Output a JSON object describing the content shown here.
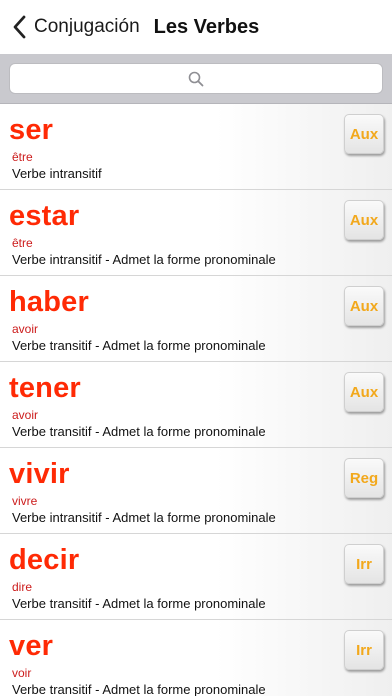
{
  "navbar": {
    "back_label": "Conjugación",
    "title": "Les Verbes"
  },
  "search": {
    "placeholder": "",
    "value": ""
  },
  "colors": {
    "verb": "#ff2a05",
    "translation": "#cc1b1b",
    "badge": "#f2a81c"
  },
  "verbs": [
    {
      "verb": "ser",
      "translation": "être",
      "description": "Verbe intransitif",
      "badge": "Aux"
    },
    {
      "verb": "estar",
      "translation": "être",
      "description": "Verbe intransitif - Admet la forme pronominale",
      "badge": "Aux"
    },
    {
      "verb": "haber",
      "translation": "avoir",
      "description": "Verbe transitif - Admet la forme pronominale",
      "badge": "Aux"
    },
    {
      "verb": "tener",
      "translation": "avoir",
      "description": "Verbe transitif - Admet la forme pronominale",
      "badge": "Aux"
    },
    {
      "verb": "vivir",
      "translation": "vivre",
      "description": "Verbe intransitif - Admet la forme pronominale",
      "badge": "Reg"
    },
    {
      "verb": "decir",
      "translation": "dire",
      "description": "Verbe transitif - Admet la forme pronominale",
      "badge": "Irr"
    },
    {
      "verb": "ver",
      "translation": "voir",
      "description": "Verbe transitif - Admet la forme pronominale",
      "badge": "Irr"
    }
  ]
}
